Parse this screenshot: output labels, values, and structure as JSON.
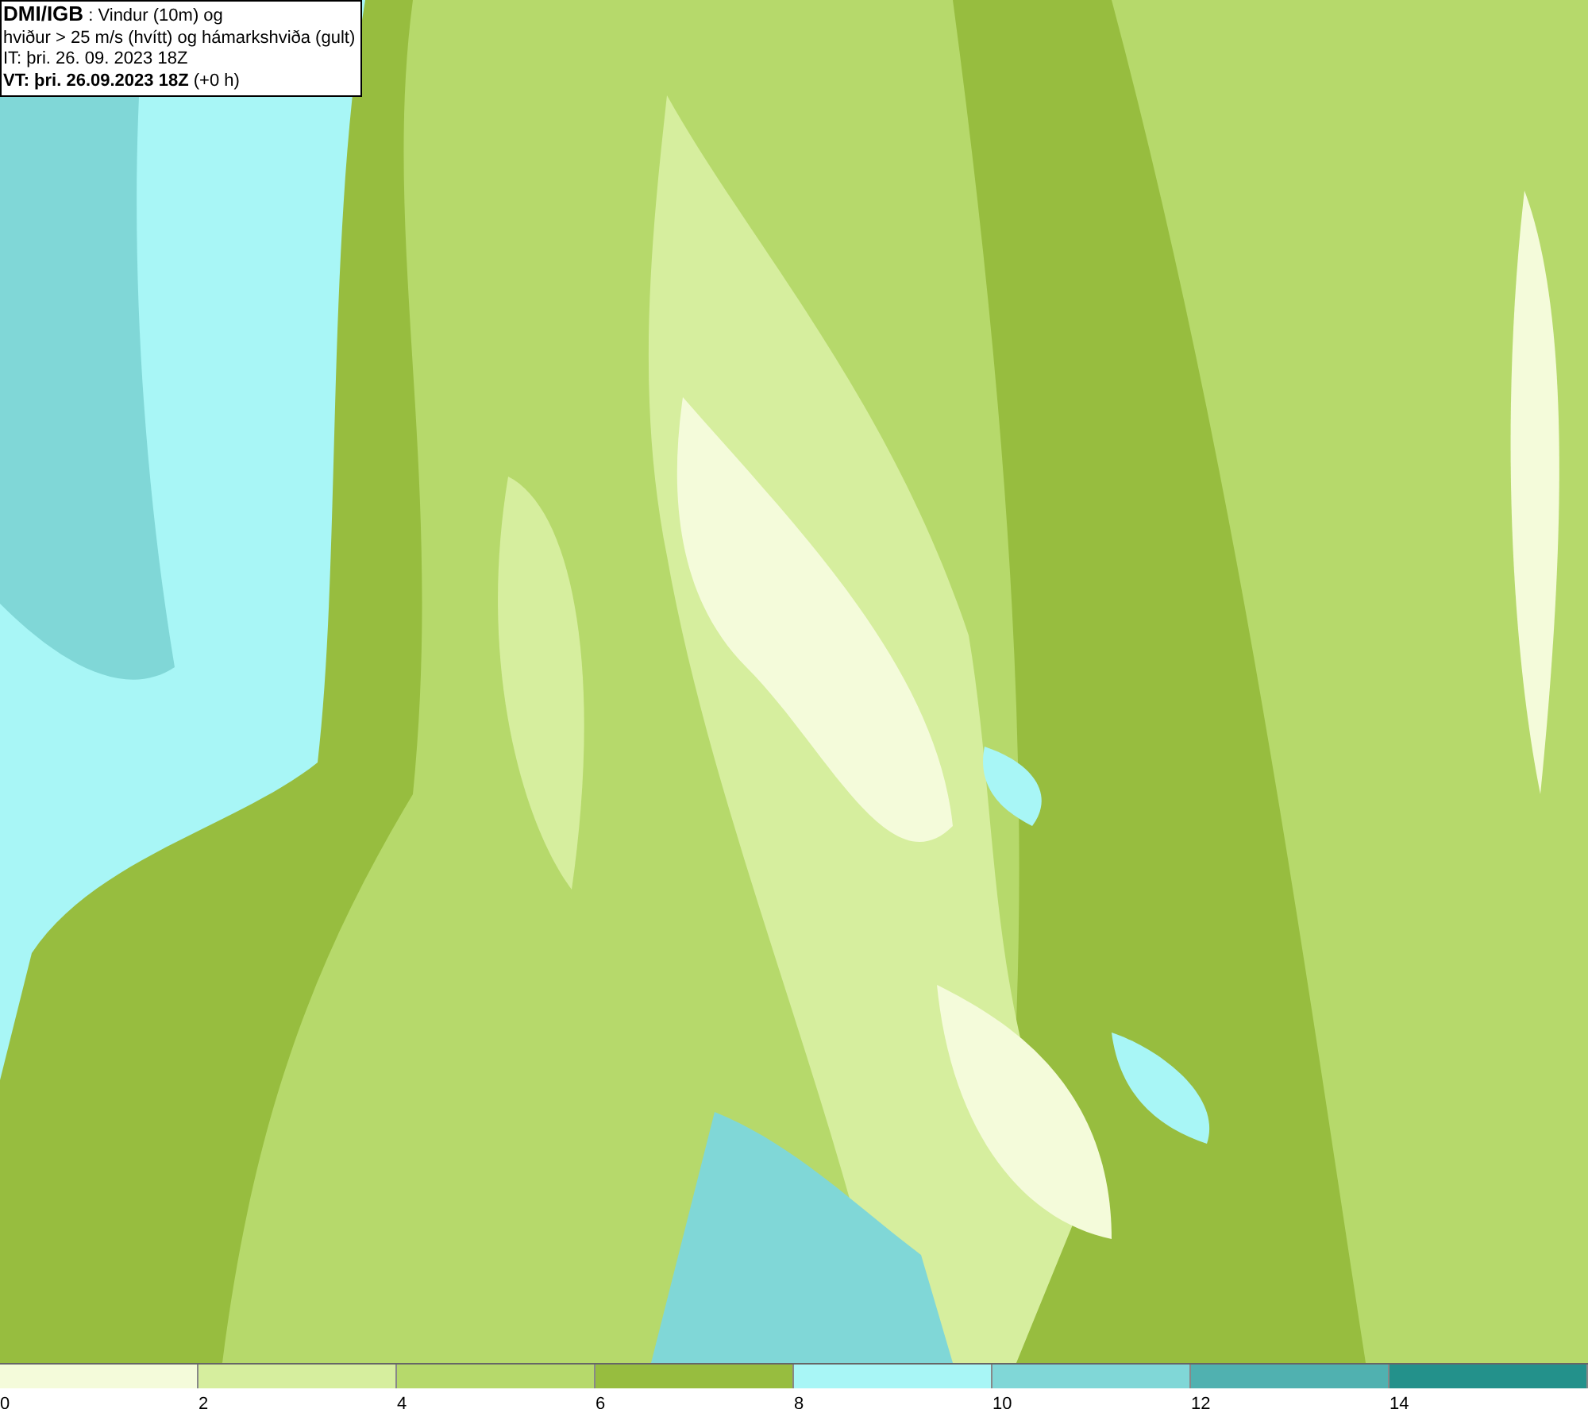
{
  "title_box": {
    "lines": [
      "**DMI/IGB** : Vindur (10m) og",
      "hviður > 25 m/s (hvítt) og hámarkshviða (gult)",
      "IT: þri. 26. 09. 2023 18Z",
      "**VT: þri. 26.09.2023 18Z** (+0 h)"
    ]
  },
  "legend": {
    "swatches": [
      {
        "color": "#f4fbda"
      },
      {
        "color": "#d6ee9e"
      },
      {
        "color": "#b6d96b"
      },
      {
        "color": "#97bd3f"
      },
      {
        "color": "#a8f6f6"
      },
      {
        "color": "#80d7d7"
      },
      {
        "color": "#50b1b0"
      },
      {
        "color": "#23918b"
      }
    ],
    "labels": [
      "0",
      "2",
      "4",
      "6",
      "8",
      "10",
      "12",
      "14"
    ]
  }
}
